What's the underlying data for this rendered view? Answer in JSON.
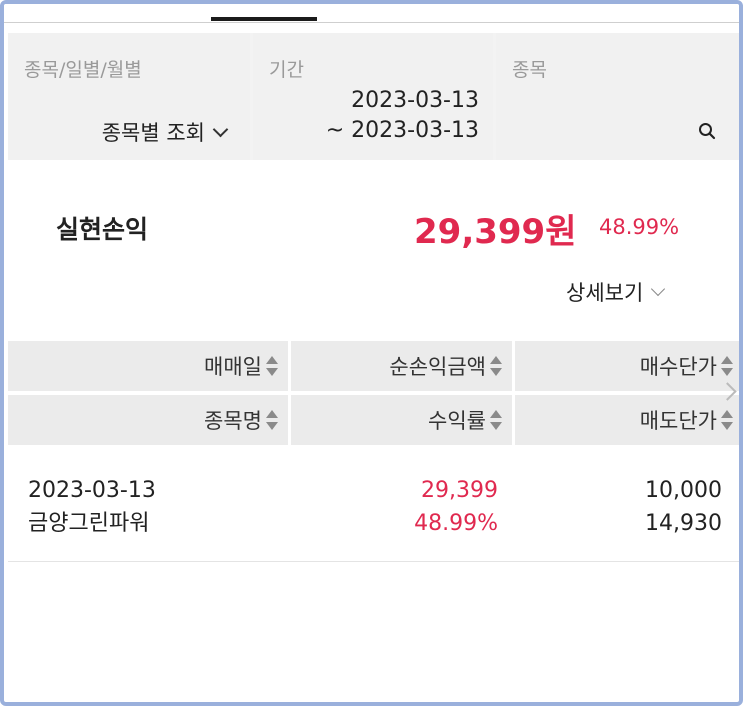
{
  "filters": {
    "type": {
      "label": "종목/일별/월별",
      "value": "종목별 조회"
    },
    "period": {
      "label": "기간",
      "start": "2023-03-13",
      "end": "~ 2023-03-13"
    },
    "stock": {
      "label": "종목"
    }
  },
  "summary": {
    "label": "실현손익",
    "amount": "29,399원",
    "rate": "48.99%",
    "detail_label": "상세보기"
  },
  "table": {
    "headers": [
      [
        "매매일",
        "순손익금액",
        "매수단가"
      ],
      [
        "종목명",
        "수익률",
        "매도단가"
      ]
    ],
    "rows": [
      {
        "date": "2023-03-13",
        "name": "금양그린파워",
        "profit": "29,399",
        "rate": "48.99%",
        "buy_price": "10,000",
        "sell_price": "14,930"
      }
    ]
  },
  "colors": {
    "accent": "#e0294f",
    "header_bg": "#ebebeb",
    "filter_bg": "#f1f1f1"
  }
}
